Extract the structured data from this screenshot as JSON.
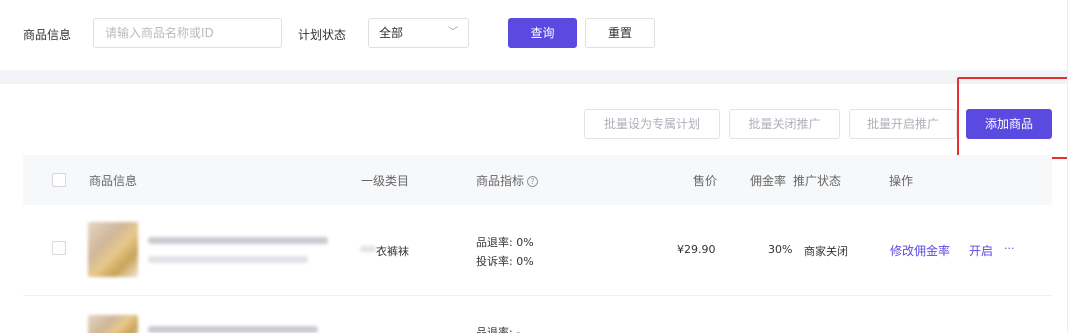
{
  "filters": {
    "product_label": "商品信息",
    "product_placeholder": "请输入商品名称或ID",
    "status_label": "计划状态",
    "status_value": "全部",
    "query_label": "查询",
    "reset_label": "重置"
  },
  "toolbar": {
    "set_exclusive_label": "批量设为专属计划",
    "batch_close_label": "批量关闭推广",
    "batch_open_label": "批量开启推广",
    "add_product_label": "添加商品"
  },
  "table": {
    "headers": {
      "product": "商品信息",
      "category": "一级类目",
      "metrics": "商品指标",
      "price": "售价",
      "commission": "佣金率",
      "status": "推广状态",
      "actions": "操作"
    },
    "rows": [
      {
        "category": "衣裤袜",
        "return_rate": "品退率: 0%",
        "complaint_rate": "投诉率: 0%",
        "price": "¥29.90",
        "commission": "30%",
        "status": "商家关闭",
        "action_edit": "修改佣金率",
        "action_open": "开启",
        "action_more": "···"
      },
      {
        "return_rate": "品退率: -"
      }
    ]
  },
  "colors": {
    "accent": "#5b4ae0",
    "highlight": "#e5312f"
  }
}
